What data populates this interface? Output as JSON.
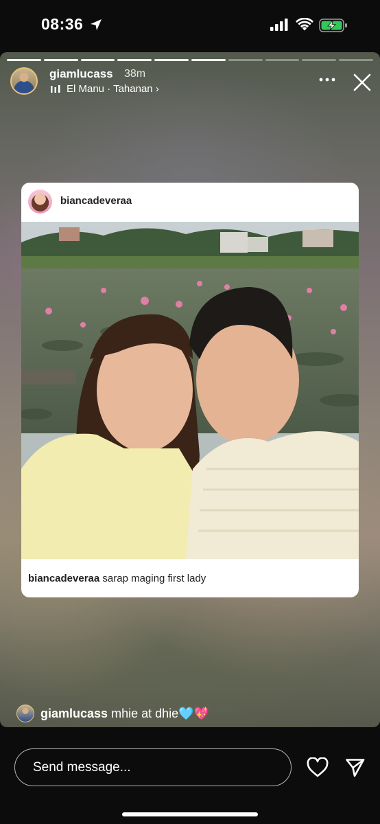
{
  "status_bar": {
    "time": "08:36",
    "location_icon": "location-arrow-icon",
    "signal_icon": "cellular-signal-icon",
    "wifi_icon": "wifi-icon",
    "battery_icon": "battery-charging-icon",
    "battery_color": "#34c759"
  },
  "story": {
    "segments_total": 10,
    "segments_viewed": 6,
    "user": {
      "username": "giamlucass",
      "time_ago": "38m"
    },
    "music": "El Manu · Tahanan",
    "music_chevron": "›",
    "shared_post": {
      "username": "biancadeveraa",
      "caption_user": "biancadeveraa",
      "caption_text": "sarap maging first lady"
    },
    "caption": {
      "username": "giamlucass",
      "text": "mhie at dhie🩵💖"
    }
  },
  "composer": {
    "placeholder": "Send message..."
  }
}
